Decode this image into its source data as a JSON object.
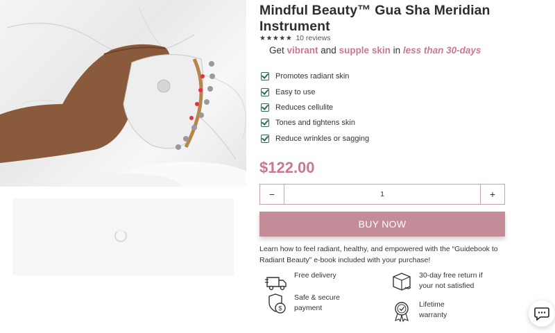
{
  "product": {
    "title": "Mindful Beauty™ Gua Sha Meridian Instrument",
    "stars": "★★★★★",
    "reviews": "10 reviews",
    "tagline": {
      "prefix": "Get ",
      "word1": "vibrant",
      "mid1": " and ",
      "word2": "supple skin",
      "mid2": " in ",
      "word3": "less than 30-days"
    },
    "benefits": [
      "Promotes radiant skin",
      "Easy to use",
      "Reduces cellulite",
      "Tones and tightens skin",
      "Reduce wrinkles or sagging"
    ],
    "price": "$122.00",
    "quantity": {
      "minus": "−",
      "value": "1",
      "plus": "+"
    },
    "buy_label": "BUY NOW",
    "promo": "Learn how to feel radiant, healthy, and empowered with the “Guidebook to Radiant Beauty” e-book included with your purchase!",
    "features": [
      {
        "icon": "truck-icon",
        "line1": "Free delivery",
        "line2": ""
      },
      {
        "icon": "box-return-icon",
        "line1": "30-day free return if",
        "line2": "your not satisfied"
      },
      {
        "icon": "shield-dollar-icon",
        "line1": "Safe & secure",
        "line2": "payment"
      },
      {
        "icon": "badge-check-icon",
        "line1": "Lifetime",
        "line2": "warranty"
      }
    ]
  },
  "colors": {
    "accent": "#c9788e",
    "button": "#c48c98",
    "check": "#2f6b4f"
  }
}
